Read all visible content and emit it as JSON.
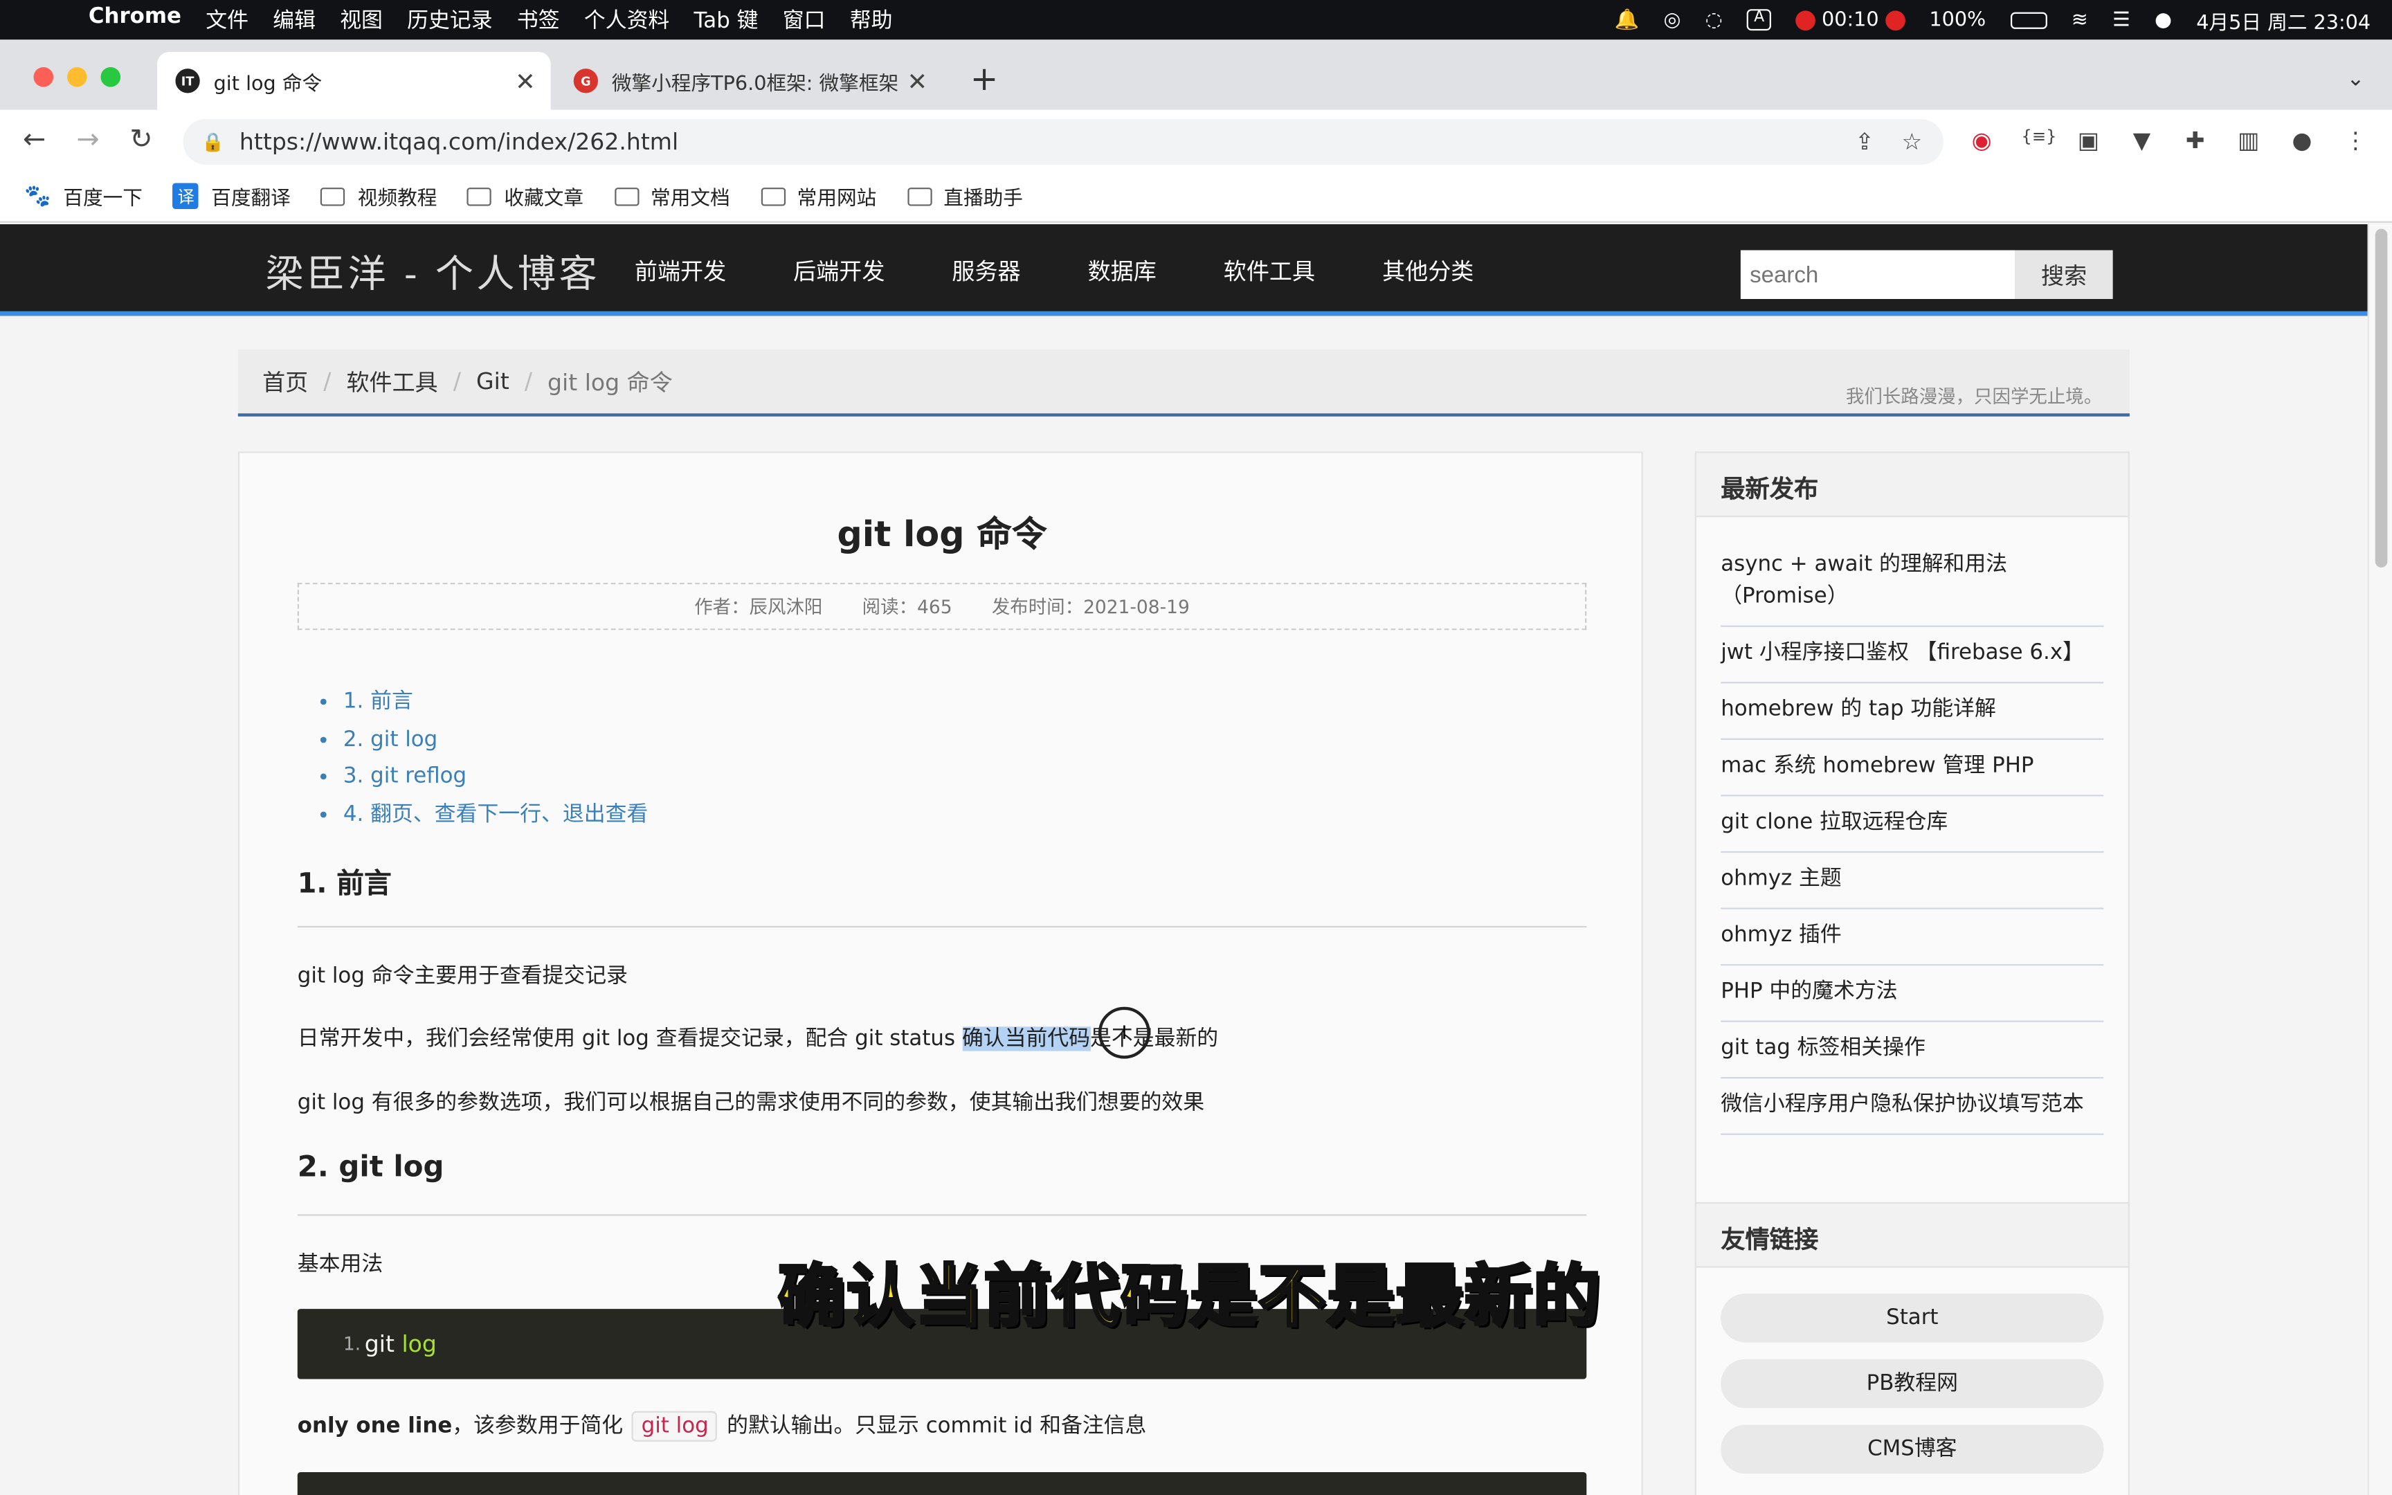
{
  "menubar": {
    "app": "Chrome",
    "items": [
      "文件",
      "编辑",
      "视图",
      "历史记录",
      "书签",
      "个人资料",
      "Tab 键",
      "窗口",
      "帮助"
    ],
    "record_time": "00:10",
    "battery": "100%",
    "datetime": "4月5日 周二  23:04"
  },
  "tabs": [
    {
      "title": "git log 命令",
      "favicon": "IT"
    },
    {
      "title": "微擎小程序TP6.0框架: 微擎框架",
      "favicon": "G"
    }
  ],
  "address": {
    "url": "https://www.itqaq.com/index/262.html"
  },
  "bookmarks": [
    "百度一下",
    "百度翻译",
    "视频教程",
    "收藏文章",
    "常用文档",
    "常用网站",
    "直播助手"
  ],
  "site": {
    "logo": "梁臣洋 - 个人博客",
    "nav": [
      "前端开发",
      "后端开发",
      "服务器",
      "数据库",
      "软件工具",
      "其他分类"
    ],
    "search_placeholder": "search",
    "search_button": "搜索"
  },
  "breadcrumb": {
    "items": [
      "首页",
      "软件工具",
      "Git",
      "git log 命令"
    ],
    "motto": "我们长路漫漫，只因学无止境。"
  },
  "article": {
    "title": "git log 命令",
    "author": "作者：辰风沐阳",
    "reads": "阅读：465",
    "date": "发布时间：2021-08-19",
    "toc": [
      "1. 前言",
      "2. git log",
      "3. git reflog",
      "4. 翻页、查看下一行、退出查看"
    ],
    "h_intro": "1. 前言",
    "p1": "git log 命令主要用于查看提交记录",
    "p2_before": "日常开发中，我们会经常使用 git log 查看提交记录，配合 git status ",
    "p2_highlight": "确认当前代码",
    "p2_after": "是不是最新的",
    "p3": "git log 有很多的参数选项，我们可以根据自己的需求使用不同的参数，使其输出我们想要的效果",
    "h_gitlog": "2. git log",
    "basic": "基本用法",
    "code_line": "1.",
    "code_cmd": "git",
    "code_arg": "log",
    "oneline_bold": "only one line",
    "oneline_mid": "，该参数用于简化",
    "oneline_code": "git log",
    "oneline_end": "的默认输出。只显示 commit id 和备注信息"
  },
  "sidebar": {
    "latest_title": "最新发布",
    "latest": [
      "async + await 的理解和用法（Promise）",
      "jwt 小程序接口鉴权 【firebase 6.x】",
      "homebrew 的 tap 功能详解",
      "mac 系统 homebrew 管理 PHP",
      "git clone 拉取远程仓库",
      "ohmyz 主题",
      "ohmyz 插件",
      "PHP 中的魔术方法",
      "git tag 标签相关操作",
      "微信小程序用户隐私保护协议填写范本"
    ],
    "links_title": "友情链接",
    "links": [
      "Start",
      "PB教程网",
      "CMS博客"
    ]
  },
  "subtitle": "确认当前代码是不是最新的"
}
